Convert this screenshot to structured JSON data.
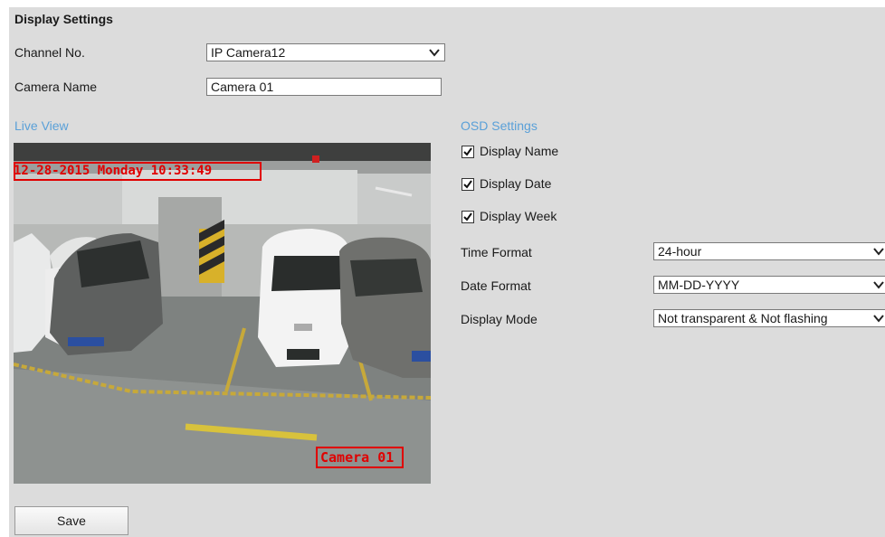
{
  "header": {
    "title": "Display Settings"
  },
  "channel": {
    "label": "Channel No.",
    "value": "IP Camera12"
  },
  "camera_name": {
    "label": "Camera Name",
    "value": "Camera 01"
  },
  "live_view": {
    "heading": "Live View",
    "osd_datetime": "12-28-2015 Monday 10:33:49",
    "osd_name": "Camera 01"
  },
  "osd_settings": {
    "heading": "OSD Settings",
    "display_name": {
      "label": "Display Name",
      "checked": true
    },
    "display_date": {
      "label": "Display Date",
      "checked": true
    },
    "display_week": {
      "label": "Display Week",
      "checked": true
    },
    "time_format": {
      "label": "Time Format",
      "value": "24-hour"
    },
    "date_format": {
      "label": "Date Format",
      "value": "MM-DD-YYYY"
    },
    "display_mode": {
      "label": "Display Mode",
      "value": "Not transparent & Not flashing"
    }
  },
  "actions": {
    "save_label": "Save"
  },
  "colors": {
    "panel_bg": "#dcdcdc",
    "section_heading": "#5aa0d8",
    "osd_red": "#e00000"
  }
}
